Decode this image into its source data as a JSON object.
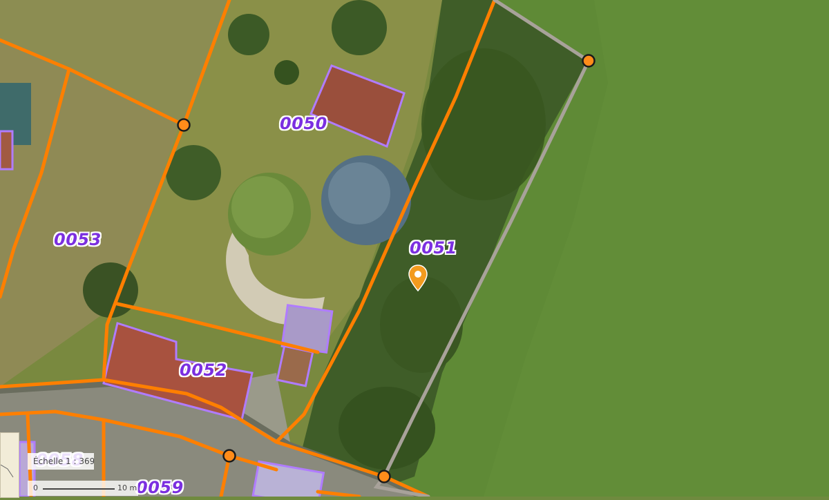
{
  "parcels": [
    {
      "id": "p0050",
      "label": "0050"
    },
    {
      "id": "p0051",
      "label": "0051"
    },
    {
      "id": "p0052",
      "label": "0052"
    },
    {
      "id": "p0053",
      "label": "0053"
    },
    {
      "id": "p0059",
      "label": "0059"
    },
    {
      "id": "p0058",
      "label": "0058"
    }
  ],
  "scale": {
    "ratio_label": "Échelle 1 : 369",
    "bar_start": "0",
    "bar_end": "10 m"
  },
  "colors": {
    "parcel_boundary": "#ff7f00",
    "selected_boundary": "#a8a29a",
    "building_outline": "#b07cff",
    "label_text": "#7b2fe0",
    "marker": "#f39b1f"
  },
  "icons": {
    "location_marker": "map-pin-icon"
  }
}
